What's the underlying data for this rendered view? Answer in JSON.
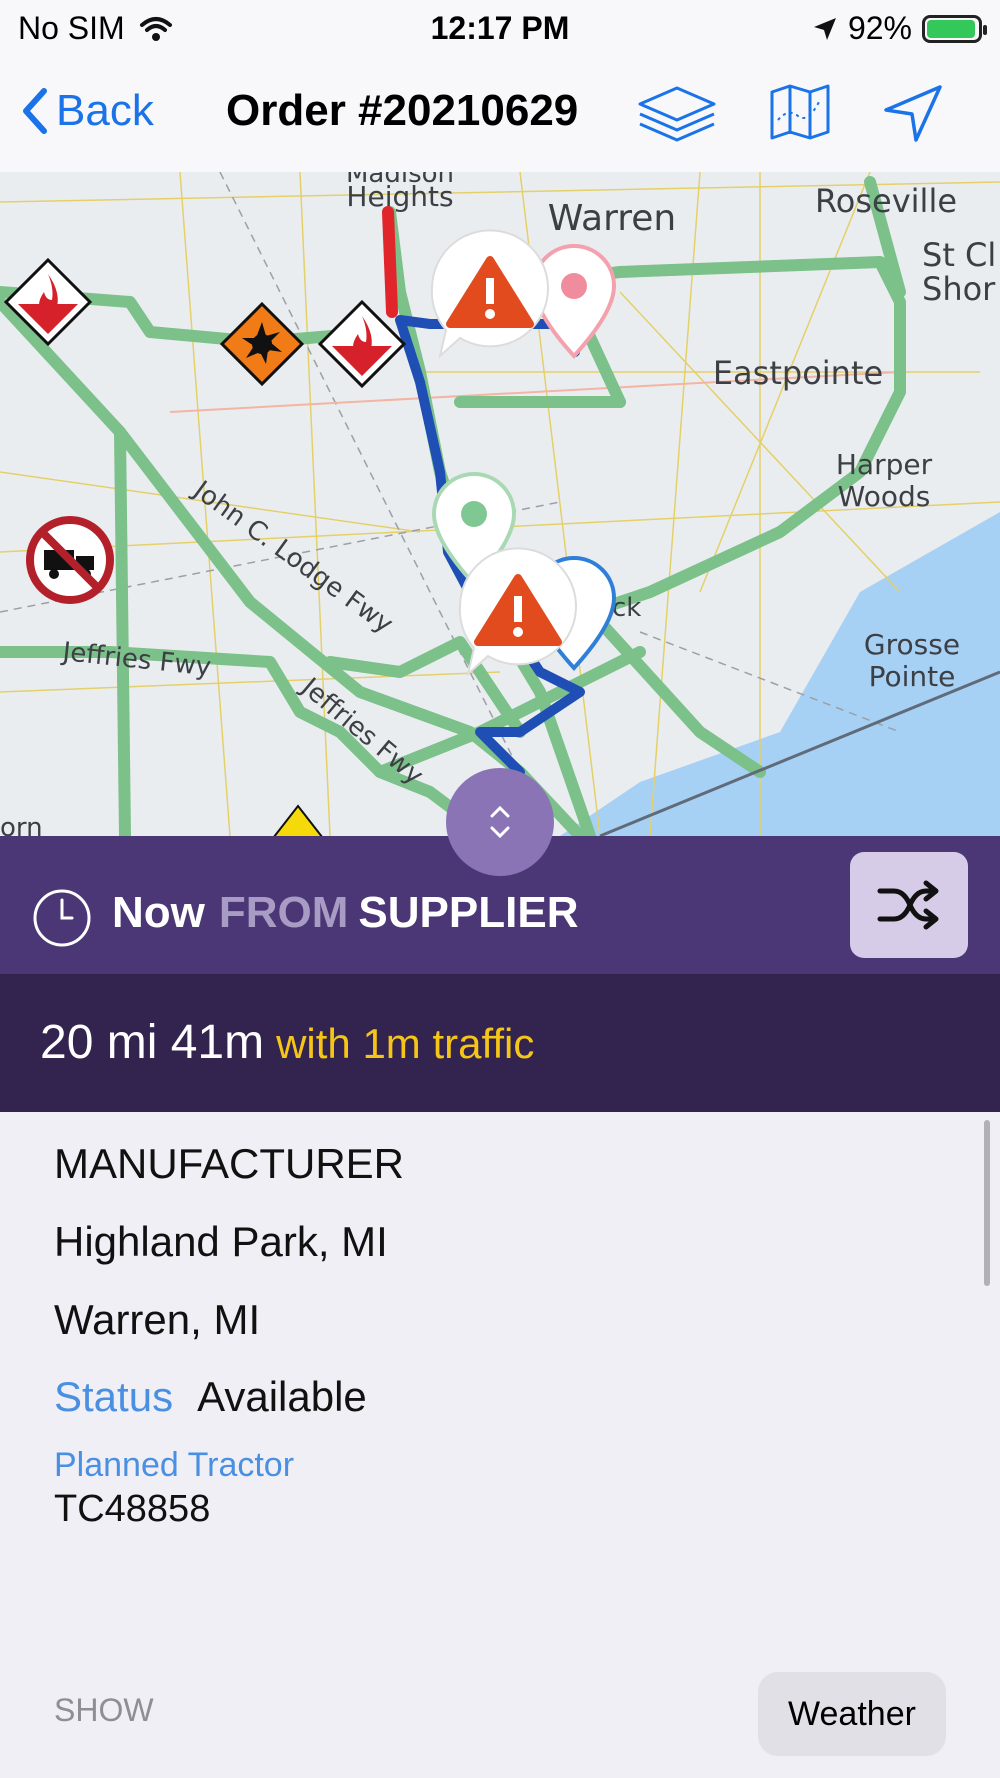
{
  "status_bar": {
    "carrier": "No SIM",
    "time": "12:17 PM",
    "battery": "92%"
  },
  "nav": {
    "back_label": "Back",
    "title": "Order #20210629"
  },
  "map": {
    "labels": {
      "madison": "Madison",
      "heights": "Heights",
      "warren": "Warren",
      "roseville": "Roseville",
      "st_clair_1": "St Cl",
      "st_clair_2": "Shor",
      "eastpointe": "Eastpointe",
      "harper_1": "Harper",
      "harper_2": "Woods",
      "lodge": "John C. Lodge Fwy",
      "jeffries_1": "Jeffries Fwy",
      "jeffries_2": "Jeffries Fwy",
      "grosse_1": "Grosse",
      "grosse_2": "Pointe",
      "hamtramck": "ck",
      "orn": "orn"
    },
    "colors": {
      "route": "#1f4fb5",
      "traffic_ok": "#7cc08a",
      "traffic_heavy": "#e0262b",
      "water": "#a7d0f5"
    }
  },
  "route": {
    "now": "Now",
    "from": "FROM",
    "origin": "SUPPLIER"
  },
  "summary": {
    "distance_time": "20 mi 41m",
    "traffic": "with 1m traffic"
  },
  "details": {
    "type": "MANUFACTURER",
    "origin_city": "Highland Park, MI",
    "destination_city": "Warren, MI",
    "status_label": "Status",
    "status_value": "Available",
    "tractor_label": "Planned Tractor",
    "tractor_value": "TC48858"
  },
  "footer": {
    "show_label": "SHOW",
    "weather_button": "Weather"
  }
}
